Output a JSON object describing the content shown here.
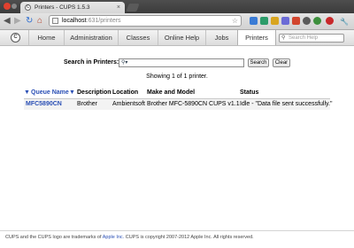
{
  "browser": {
    "tab_title": "Printers - CUPS 1.5.3",
    "tab_close": "×",
    "url_host": "localhost",
    "url_path": ":631/printers"
  },
  "icons": {
    "back": "◀",
    "forward": "▶",
    "reload": "↻",
    "home": "⌂",
    "star": "☆",
    "wrench": "🔧",
    "search": "🔍"
  },
  "cups_nav": {
    "tabs": [
      "Home",
      "Administration",
      "Classes",
      "Online Help",
      "Jobs",
      "Printers"
    ],
    "active": "Printers",
    "search_placeholder": "Search Help"
  },
  "content": {
    "search_label": "Search in Printers:",
    "search_button": "Search",
    "clear_button": "Clear",
    "showing": "Showing 1 of 1 printer.",
    "table": {
      "headers": [
        "Queue Name",
        "Description",
        "Location",
        "Make and Model",
        "Status"
      ],
      "sort_arrow_left": "▼",
      "sort_arrow_right": "▼",
      "rows": [
        [
          "MFC5890CN",
          "Brother",
          "Ambientsoft",
          "Brother MFC-5890CN CUPS v1.1",
          "Idle - \"Data file sent successfully.\""
        ]
      ]
    }
  },
  "footer": {
    "text_pre": "CUPS and the CUPS logo are trademarks of ",
    "link1": "Apple Inc.",
    "text_mid": " CUPS is copyright 2007-2012 Apple Inc. All rights reserved."
  },
  "colors": {
    "link": "#2a4fb5",
    "close_btn": "#e0412f",
    "min_btn": "#f0a832",
    "max_btn": "#6cb44a"
  }
}
